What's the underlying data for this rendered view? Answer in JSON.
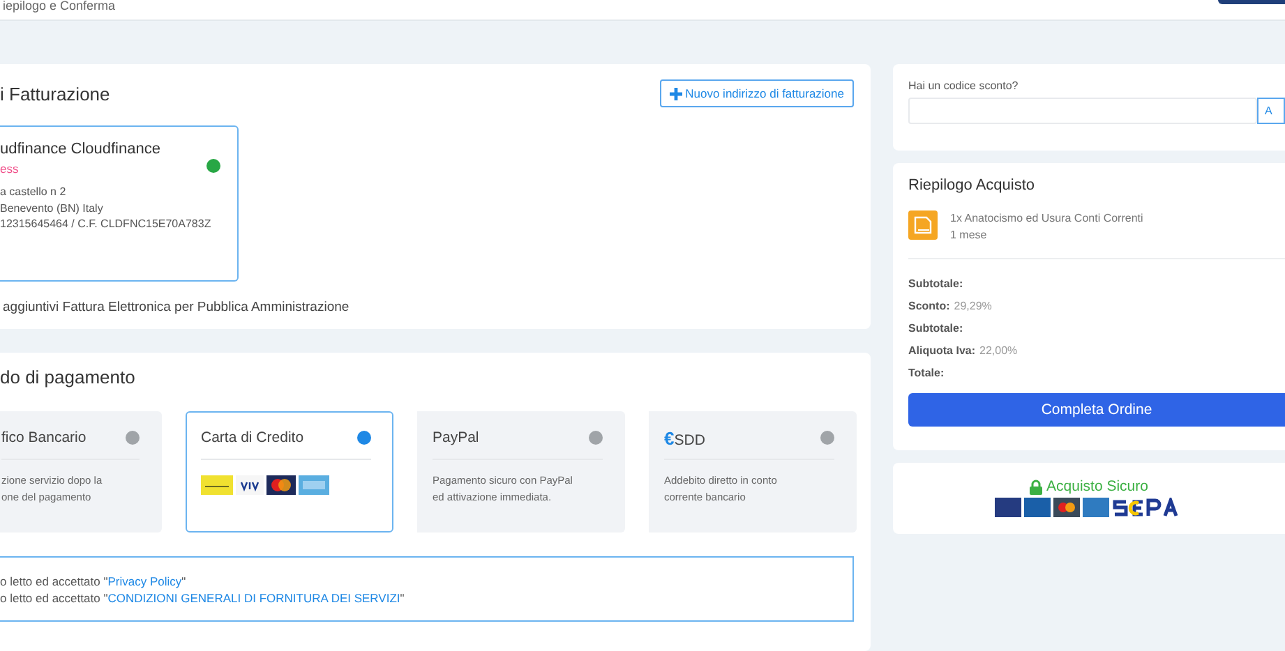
{
  "header": {
    "step": "iepilogo e Conferma"
  },
  "billing": {
    "title": "i Fatturazione",
    "new_button": "Nuovo indirizzo di fatturazione",
    "addresses": [
      {
        "name": "udfinance Cloudfinance",
        "tag": "ess",
        "lines": [
          "a castello n 2",
          " Benevento (BN) Italy",
          "12315645464 / C.F. CLDFNC15E70A783Z"
        ],
        "selected": true
      }
    ],
    "extra": "aggiuntivi Fattura Elettronica per Pubblica Amministrazione"
  },
  "payment": {
    "title": "do di pagamento",
    "methods": [
      {
        "kind": "text",
        "title": "fico Bancario",
        "description": "zione servizio dopo la\none del pagamento",
        "selected": false
      },
      {
        "kind": "logos",
        "title": "Carta di Credito",
        "selected": true
      },
      {
        "kind": "text",
        "title": "PayPal",
        "description": "Pagamento sicuro con PayPal\ned attivazione immediata.",
        "selected": false
      },
      {
        "kind": "text",
        "prefix": "€",
        "title": "SDD",
        "description": "Addebito diretto in conto\ncorrente bancario",
        "selected": false
      }
    ],
    "consents": [
      {
        "text": "o letto ed accettato \"",
        "link": "Privacy Policy",
        "after": "\""
      },
      {
        "text": "o letto ed accettato \"",
        "link": "CONDIZIONI GENERALI DI FORNITURA DEI SERVIZI",
        "after": "\""
      }
    ]
  },
  "discount": {
    "label": "Hai un codice sconto?",
    "button": "A"
  },
  "summary": {
    "title": "Riepilogo Acquisto",
    "product": {
      "name": "1x Anatocismo ed Usura Conti Correnti",
      "period": "1 mese"
    },
    "rows": [
      {
        "label": "Subtotale:"
      },
      {
        "label": "Sconto:",
        "value": "29,29%"
      },
      {
        "label": "Subtotale:"
      },
      {
        "label": "Aliquota Iva:",
        "value": "22,00%"
      },
      {
        "label": "Totale:"
      }
    ],
    "button": "Completa Ordine"
  },
  "secure": {
    "title": "Acquisto Sicuro"
  }
}
